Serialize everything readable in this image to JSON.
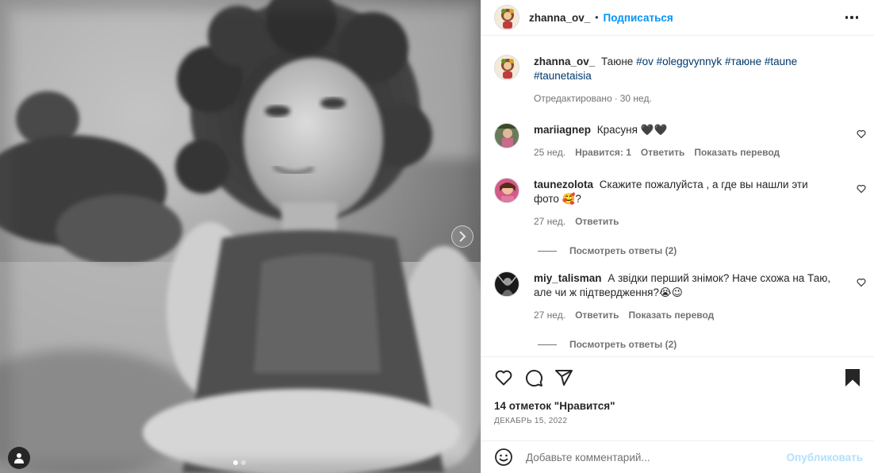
{
  "post": {
    "author": "zhanna_ov_",
    "separator": "•",
    "follow_label": "Подписаться",
    "caption_text": "Таюне",
    "hashtags": [
      "#ov",
      "#oleggvynnyk",
      "#таюне",
      "#taune",
      "#taunetaisia"
    ],
    "edited_label": "Отредактировано",
    "meta_separator": "·",
    "caption_age": "30 нед.",
    "likes": "14 отметок \"Нравится\"",
    "date": "ДЕКАБРЬ 15, 2022"
  },
  "comments": [
    {
      "user": "mariiagnep",
      "text": "Красуня 🖤🖤",
      "age": "25 нед.",
      "likes_label": "Нравится: 1",
      "reply_label": "Ответить",
      "translate_label": "Показать перевод"
    },
    {
      "user": "taunezolota",
      "text": "Скажите пожалуйста , а где вы нашли эти фото 🥰?",
      "age": "27 нед.",
      "reply_label": "Ответить",
      "view_replies": "Посмотреть ответы (2)"
    },
    {
      "user": "miy_talisman",
      "text": "А звідки перший знімок? Наче схожа на Таю, але чи ж підтвердження?😭😉",
      "age": "27 нед.",
      "reply_label": "Ответить",
      "translate_label": "Показать перевод",
      "view_replies": "Посмотреть ответы (2)"
    }
  ],
  "composer": {
    "placeholder": "Добавьте комментарий...",
    "post_label": "Опубликовать"
  },
  "carousel": {
    "slide_count": 2,
    "active_slide": 1
  },
  "icons": [
    "next-chevron-icon",
    "tagged-user-icon",
    "more-options-icon",
    "heart-icon",
    "comment-icon",
    "share-icon",
    "bookmark-icon",
    "emoji-icon"
  ],
  "colors": {
    "accent": "#0095f6",
    "hashtag": "#00376b",
    "muted": "#737373",
    "post_disabled": "#b2dffc",
    "text": "#262626"
  }
}
